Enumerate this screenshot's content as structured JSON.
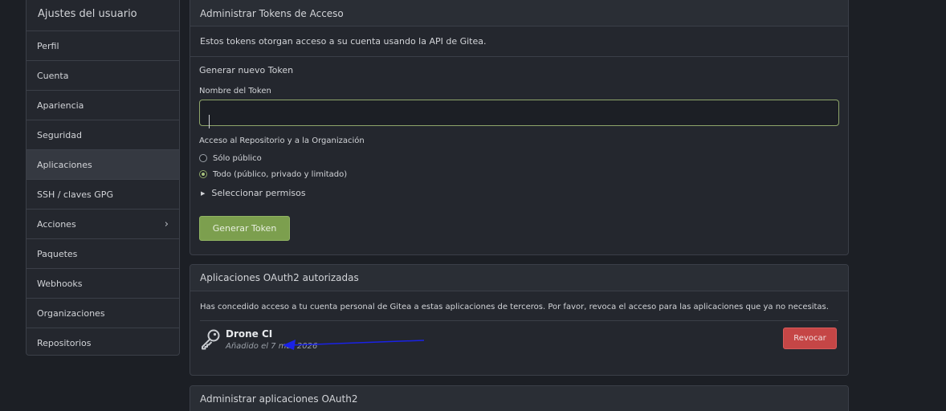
{
  "sidebar": {
    "title": "Ajustes del usuario",
    "items": [
      {
        "label": "Perfil"
      },
      {
        "label": "Cuenta"
      },
      {
        "label": "Apariencia"
      },
      {
        "label": "Seguridad"
      },
      {
        "label": "Aplicaciones"
      },
      {
        "label": "SSH / claves GPG"
      },
      {
        "label": "Acciones"
      },
      {
        "label": "Paquetes"
      },
      {
        "label": "Webhooks"
      },
      {
        "label": "Organizaciones"
      },
      {
        "label": "Repositorios"
      }
    ],
    "active": "Aplicaciones"
  },
  "tokens": {
    "title": "Administrar Tokens de Acceso",
    "description": "Estos tokens otorgan acceso a su cuenta usando la API de Gitea.",
    "new_token_title": "Generar nuevo Token",
    "name_label": "Nombre del Token",
    "name_value": "",
    "access_label": "Acceso al Repositorio y a la Organización",
    "radio_public": "Sólo público",
    "radio_all": "Todo (público, privado y limitado)",
    "selected_radio": "all",
    "permissions_label": "Seleccionar permisos",
    "generate_button": "Generar Token"
  },
  "oauth_authorized": {
    "title": "Aplicaciones OAuth2 autorizadas",
    "description": "Has concedido acceso a tu cuenta personal de Gitea a estas aplicaciones de terceros. Por favor, revoca el acceso para las aplicaciones que ya no necesitas.",
    "apps": [
      {
        "name": "Drone CI",
        "added": "Añadido el 7 mar 2026",
        "revoke_label": "Revocar"
      }
    ]
  },
  "oauth_manage": {
    "title": "Administrar aplicaciones OAuth2"
  },
  "colors": {
    "background": "#1c1f25",
    "panel": "#24272e",
    "primary_button": "#7c9f4e",
    "danger_button": "#c54646",
    "annotation_arrow": "#1a22e6"
  }
}
